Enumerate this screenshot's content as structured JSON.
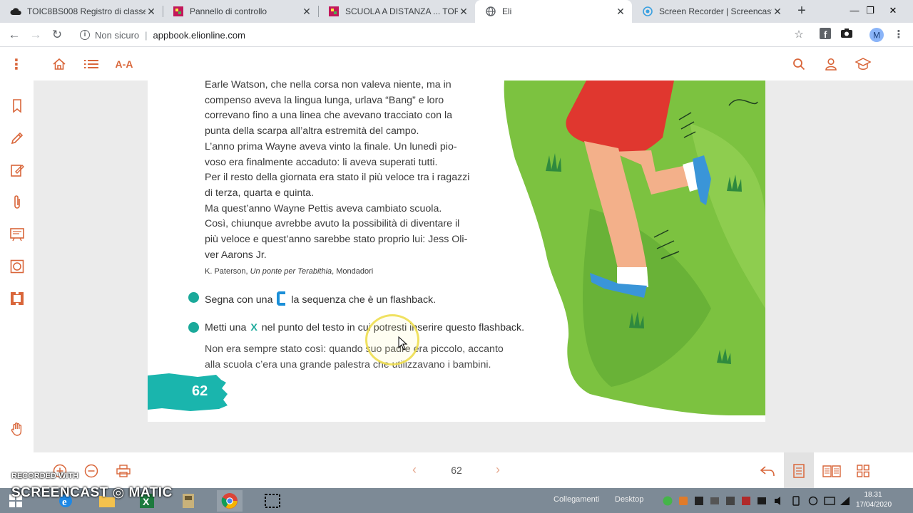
{
  "browser": {
    "tabs": [
      {
        "title": "TOIC8BS008 Registro di classe 1"
      },
      {
        "title": "Pannello di controllo"
      },
      {
        "title": "SCUOLA A DISTANZA ... TORRE"
      },
      {
        "title": "Eli"
      },
      {
        "title": "Screen Recorder | Screencast-O"
      }
    ],
    "security_label": "Non sicuro",
    "url": "appbook.elionline.com",
    "profile_initial": "M"
  },
  "app": {
    "font_size_label": "A-A",
    "accent_color": "#d9663a"
  },
  "book": {
    "paragraph_lines": [
      "Earle Watson, che nella corsa non valeva niente, ma in",
      "compenso aveva la lingua lunga, urlava “Bang” e loro",
      "correvano fino a una linea che avevano tracciato con la",
      "punta della scarpa all’altra estremità del campo.",
      "L’anno prima Wayne aveva vinto la finale. Un lunedì pio-",
      "voso era finalmente accaduto: li aveva superati tutti.",
      "Per il resto della giornata era stato il più veloce tra i ragazzi",
      "di terza, quarta e quinta.",
      "Ma quest’anno Wayne Pettis aveva cambiato scuola.",
      "Così, chiunque avrebbe avuto la possibilità di diventare il",
      "più veloce e quest’anno sarebbe stato proprio lui: Jess Oli-",
      "ver Aarons Jr."
    ],
    "citation_author": "K. Paterson, ",
    "citation_title": "Un ponte per Terabithia",
    "citation_publisher": ", Mondadori",
    "exercise1_before": "Segna con una",
    "exercise1_after": "la sequenza che è un flashback.",
    "exercise2_before": "Metti una",
    "exercise2_mark": "X",
    "exercise2_after": "nel punto del testo in cui potresti inserire questo flashback.",
    "answer_lines": [
      "Non era sempre stato così: quando suo padre era piccolo, accanto",
      "alla scuola c’era una grande palestra che utilizzavano i bambini."
    ],
    "page_number": "62"
  },
  "pager": {
    "current_page": "62"
  },
  "taskbar": {
    "links_label": "Collegamenti",
    "desktop_label": "Desktop",
    "time": "18.31",
    "date": "17/04/2020"
  },
  "watermark": {
    "line1": "RECORDED WITH",
    "line2": "SCREENCAST ◎ MATIC"
  }
}
